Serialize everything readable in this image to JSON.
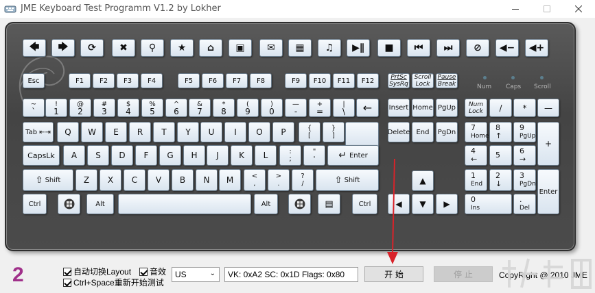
{
  "window": {
    "title": "JME Keyboard Test Programm V1.2 by Lokher",
    "minimize_label": "—",
    "maximize_label": "☐",
    "close_label": "✕"
  },
  "media_keys": [
    {
      "name": "back",
      "glyph": "🡄"
    },
    {
      "name": "forward",
      "glyph": "🡆"
    },
    {
      "name": "refresh",
      "glyph": "⟳"
    },
    {
      "name": "stop",
      "glyph": "✖"
    },
    {
      "name": "search",
      "glyph": "⚲"
    },
    {
      "name": "favorites",
      "glyph": "★"
    },
    {
      "name": "home",
      "glyph": "⌂"
    },
    {
      "name": "my-computer",
      "glyph": "▣"
    },
    {
      "name": "mail",
      "glyph": "✉"
    },
    {
      "name": "calculator",
      "glyph": "▦"
    },
    {
      "name": "media",
      "glyph": "♫"
    },
    {
      "name": "play-pause",
      "glyph": "▶∥"
    },
    {
      "name": "media-stop",
      "glyph": "■"
    },
    {
      "name": "previous-track",
      "glyph": "⏮"
    },
    {
      "name": "next-track",
      "glyph": "⏭"
    },
    {
      "name": "mute",
      "glyph": "⊘"
    },
    {
      "name": "volume-down",
      "glyph": "◀−"
    },
    {
      "name": "volume-up",
      "glyph": "◀+"
    }
  ],
  "keys": {
    "esc": "Esc",
    "f1": "F1",
    "f2": "F2",
    "f3": "F3",
    "f4": "F4",
    "f5": "F5",
    "f6": "F6",
    "f7": "F7",
    "f8": "F8",
    "f9": "F9",
    "f10": "F10",
    "f11": "F11",
    "f12": "F12",
    "prtsc_top": "PrtSc",
    "prtsc_bottom": "SysRq",
    "scroll_top": "Scroll",
    "scroll_bottom": "Lock",
    "pause_top": "Pause",
    "pause_bottom": "Break",
    "row1": [
      {
        "top": "~",
        "bottom": "`"
      },
      {
        "top": "!",
        "bottom": "1"
      },
      {
        "top": "@",
        "bottom": "2"
      },
      {
        "top": "#",
        "bottom": "3"
      },
      {
        "top": "$",
        "bottom": "4"
      },
      {
        "top": "%",
        "bottom": "5"
      },
      {
        "top": "^",
        "bottom": "6"
      },
      {
        "top": "&",
        "bottom": "7"
      },
      {
        "top": "*",
        "bottom": "8"
      },
      {
        "top": "(",
        "bottom": "9"
      },
      {
        "top": ")",
        "bottom": "0"
      },
      {
        "top": "—",
        "bottom": "-"
      },
      {
        "top": "+",
        "bottom": "="
      },
      {
        "top": "|",
        "bottom": "\\"
      }
    ],
    "backspace": "←",
    "tab": "Tab",
    "row2": [
      "Q",
      "W",
      "E",
      "R",
      "T",
      "Y",
      "U",
      "I",
      "O",
      "P"
    ],
    "lbrace_top": "{",
    "lbrace_bottom": "[",
    "rbrace_top": "}",
    "rbrace_bottom": "]",
    "capslock": "CapsLk",
    "row3": [
      "A",
      "S",
      "D",
      "F",
      "G",
      "H",
      "J",
      "K",
      "L"
    ],
    "colon_top": ":",
    "colon_bottom": ";",
    "quote_top": "\"",
    "quote_bottom": "'",
    "enter": "Enter",
    "lshift": "Shift",
    "row4": [
      "Z",
      "X",
      "C",
      "V",
      "B",
      "N",
      "M"
    ],
    "comma_top": "<",
    "comma_bottom": ",",
    "period_top": ">",
    "period_bottom": ".",
    "slash_top": "?",
    "slash_bottom": "/",
    "rshift": "Shift",
    "lctrl": "Ctrl",
    "lalt": "Alt",
    "ralt": "Alt",
    "rctrl": "Ctrl",
    "insert": "Insert",
    "home": "Home",
    "pgup": "PgUp",
    "delete": "Delete",
    "end": "End",
    "pgdn": "PgDn",
    "numlock_top": "Num",
    "numlock_bottom": "Lock",
    "num_div": "/",
    "num_mul": "*",
    "num_minus": "—",
    "num_plus": "+",
    "num7_top": "7",
    "num7_bottom": "Home",
    "num8_top": "8",
    "num8_bottom": "↑",
    "num9_top": "9",
    "num9_bottom": "PgUp",
    "num4_top": "4",
    "num4_bottom": "←",
    "num5_top": "5",
    "num6_top": "6",
    "num6_bottom": "→",
    "num1_top": "1",
    "num1_bottom": "End",
    "num2_top": "2",
    "num2_bottom": "↓",
    "num3_top": "3",
    "num3_bottom": "PgDn",
    "num0_top": "0",
    "num0_bottom": "Ins",
    "numdot_top": ".",
    "numdot_bottom": "Del",
    "num_enter": "Enter"
  },
  "leds": {
    "num": "Num",
    "caps": "Caps",
    "scroll": "Scroll"
  },
  "bottom": {
    "number": "2",
    "auto_switch_label": "自动切换Layout",
    "sound_label": "音效",
    "restart_label": "Ctrl+Space重新开始测试",
    "layout_value": "US",
    "status_text": "VK: 0xA2  SC: 0x1D  Flags: 0x80",
    "start_label": "开 始",
    "stop_label": "停 止",
    "copyright": "CopyRight @ 2010 JME"
  },
  "colors": {
    "annotation_arrow": "#d8232a",
    "number": "#a0308a"
  }
}
